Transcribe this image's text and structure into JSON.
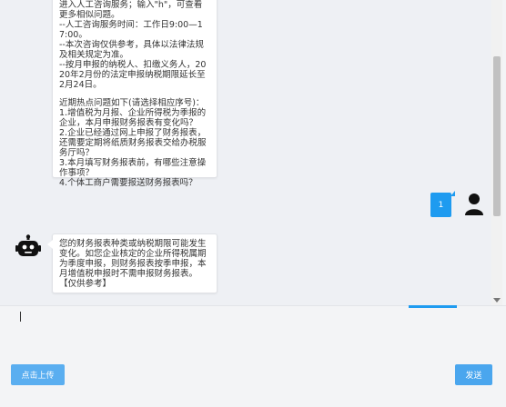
{
  "bot_message_1": {
    "lines": [
      "进入人工咨询服务；输入\"h\"，可查看更多相似问题。",
      "--人工咨询服务时间：工作日9:00—17:00。",
      "--本次咨询仅供参考，具体以法律法规及相关规定为准。",
      "--按月申报的纳税人、扣缴义务人，2020年2月份的法定申报纳税期限延长至2月24日。"
    ],
    "hot_title": "近期热点问题如下(请选择相应序号)：",
    "hot_items": [
      "1.增值税为月报、企业所得税为季报的企业，本月申报财务报表有变化吗？",
      "2.企业已经通过网上申报了财务报表，还需要定期将纸质财务报表交给办税服务厅吗？",
      "3.本月填写财务报表前，有哪些注意操作事项？",
      "4.个体工商户需要报送财务报表吗？"
    ]
  },
  "user_message": {
    "text": "1"
  },
  "bot_message_2": {
    "text": "您的财务报表种类或纳税期限可能发生变化。如您企业核定的企业所得税属期为季度申报，则财务报表按季申报，本月增值税申报时不需申报财务报表。",
    "tag": "【仅供参考】"
  },
  "input": {
    "value": ""
  },
  "buttons": {
    "upload": "点击上传",
    "send": "发送"
  },
  "colors": {
    "primary": "#1e9bf0",
    "button": "#5aaef0",
    "chat_bg": "#eef0f4"
  },
  "icons": {
    "bot_avatar": "robot-icon",
    "user_avatar": "user-icon"
  }
}
